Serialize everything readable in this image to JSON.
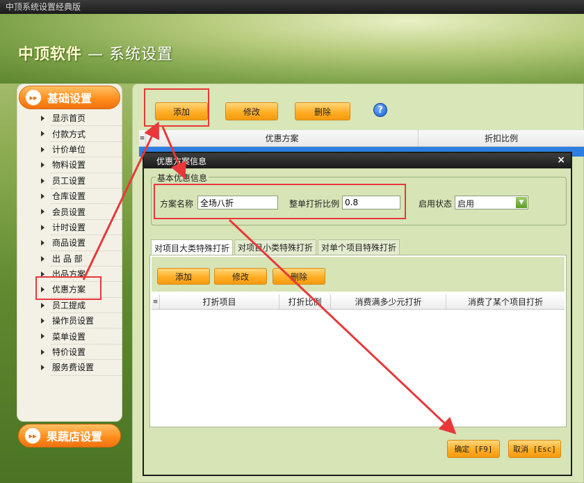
{
  "window": {
    "title": "中顶系统设置经典版"
  },
  "header": {
    "brand": "中顶软件",
    "separator": "—",
    "title": "系统设置"
  },
  "sidebar": {
    "group_basic": "基础设置",
    "group_fruit": "果蔬店设置",
    "items": [
      "显示首页",
      "付款方式",
      "计价单位",
      "物料设置",
      "员工设置",
      "仓库设置",
      "会员设置",
      "计时设置",
      "商品设置",
      "出 品 部",
      "出品方案",
      "优惠方案",
      "员工提成",
      "操作员设置",
      "菜单设置",
      "特价设置",
      "服务费设置"
    ]
  },
  "toolbar": {
    "add": "添加",
    "edit": "修改",
    "delete": "删除",
    "help": "?"
  },
  "main_table": {
    "columns": [
      "优惠方案",
      "折扣比例"
    ]
  },
  "dialog": {
    "title": "优惠方案信息",
    "close": "×",
    "group_title": "基本优惠信息",
    "name_label": "方案名称",
    "name_value": "全场八折",
    "ratio_label": "整单打折比例",
    "ratio_value": "0.8",
    "status_label": "启用状态",
    "status_value": "启用",
    "tabs": [
      "对项目大类特殊打折",
      "对项目小类特殊打折",
      "对单个项目特殊打折"
    ],
    "tab_toolbar": {
      "add": "添加",
      "edit": "修改",
      "delete": "删除"
    },
    "sub_columns": [
      "打折项目",
      "打折比例",
      "消费满多少元打折",
      "消费了某个项目打折"
    ],
    "ok": "确定 [F9]",
    "cancel": "取消 [Esc]"
  },
  "colors": {
    "accent_orange": "#ff9a1a",
    "annotation_red": "#e8383a",
    "title_bar": "#1c1c1c",
    "panel_green": "#d9e6b8"
  }
}
